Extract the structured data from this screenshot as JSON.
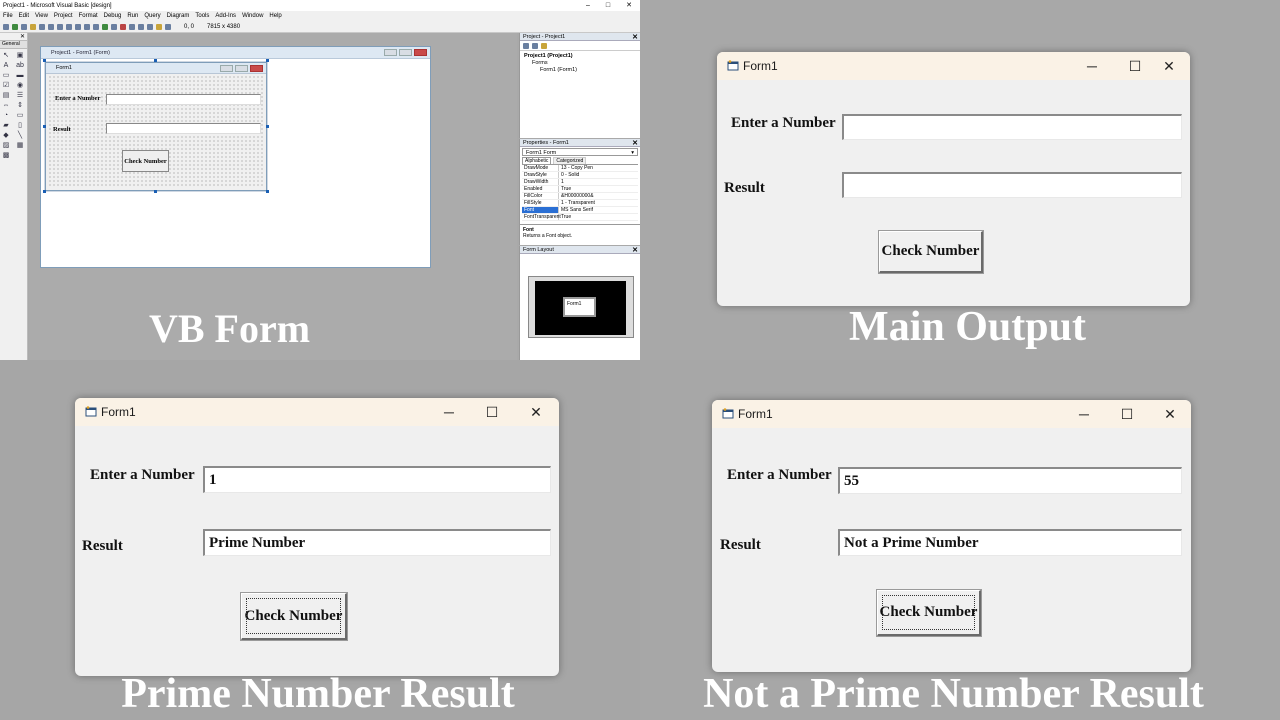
{
  "captions": {
    "vb_form": "VB Form",
    "main_output": "Main Output",
    "prime_result": "Prime Number Result",
    "not_prime_result": "Not a Prime Number Result"
  },
  "ide": {
    "title": "Project1 - Microsoft Visual Basic [design]",
    "window_controls": [
      "–",
      "□",
      "✕"
    ],
    "menu": [
      "File",
      "Edit",
      "View",
      "Project",
      "Format",
      "Debug",
      "Run",
      "Query",
      "Diagram",
      "Tools",
      "Add-Ins",
      "Window",
      "Help"
    ],
    "coords": "0, 0",
    "size": "7815 x 4380",
    "toolbox_label": "General",
    "designer_title": "Project1 - Form1 (Form)",
    "form_caption": "Form1",
    "label_enter": "Enter a Number",
    "label_result": "Result",
    "button_label": "Check Number",
    "project_panel": {
      "title": "Project - Project1",
      "root": "Project1 (Project1)",
      "folder": "Forms",
      "item": "Form1 (Form1)"
    },
    "properties_panel": {
      "title": "Properties - Form1",
      "object": "Form1 Form",
      "tabs": [
        "Alphabetic",
        "Categorized"
      ],
      "rows": [
        {
          "name": "DrawMode",
          "value": "13 - Copy Pen"
        },
        {
          "name": "DrawStyle",
          "value": "0 - Solid"
        },
        {
          "name": "DrawWidth",
          "value": "1"
        },
        {
          "name": "Enabled",
          "value": "True"
        },
        {
          "name": "FillColor",
          "value": "&H00000000&"
        },
        {
          "name": "FillStyle",
          "value": "1 - Transparent"
        },
        {
          "name": "Font",
          "value": "MS Sans Serif"
        },
        {
          "name": "FontTransparent",
          "value": "True"
        }
      ],
      "desc_title": "Font",
      "desc_text": "Returns a Font object."
    },
    "layout_panel": {
      "title": "Form Layout",
      "form_label": "Form1"
    }
  },
  "windows": [
    {
      "title": "Form1",
      "label_enter": "Enter a Number",
      "label_result": "Result",
      "input_value": "",
      "result_value": "",
      "button_label": "Check Number"
    },
    {
      "title": "Form1",
      "label_enter": "Enter a Number",
      "label_result": "Result",
      "input_value": "1",
      "result_value": "Prime Number",
      "button_label": "Check Number"
    },
    {
      "title": "Form1",
      "label_enter": "Enter a Number",
      "label_result": "Result",
      "input_value": "55",
      "result_value": "Not a Prime Number",
      "button_label": "Check Number"
    }
  ],
  "window_controls": {
    "minimize": "─",
    "maximize": "☐",
    "close": "✕"
  }
}
